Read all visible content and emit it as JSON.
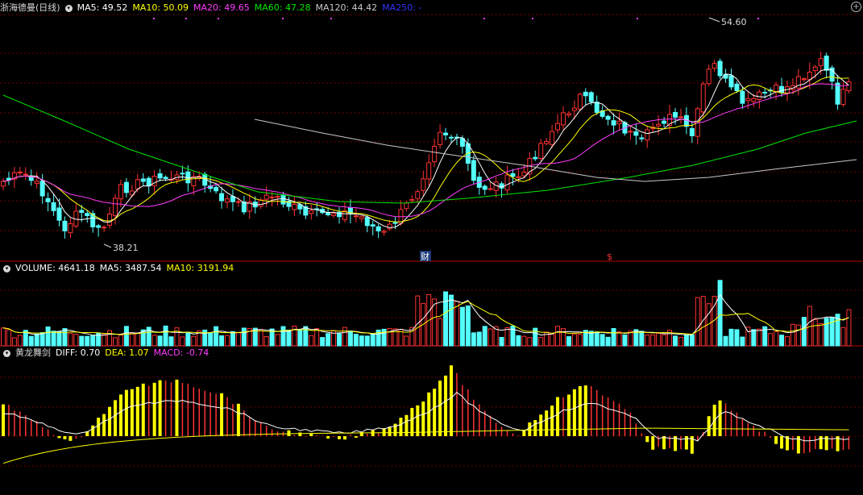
{
  "header_price": {
    "title": "浙海德曼(日线)",
    "ma5": "MA5: 49.52",
    "ma10": "MA10: 50.09",
    "ma20": "MA20: 49.65",
    "ma60": "MA60: 47.28",
    "ma120": "MA120: 44.42",
    "ma250": "MA250: -"
  },
  "header_volume": {
    "title": "VOLUME: 4641.18",
    "ma5": "MA5: 3487.54",
    "ma10": "MA10: 3191.94"
  },
  "header_macd": {
    "title": "黄龙舞剑",
    "diff": "DIFF: 0.70",
    "dea": "DEA: 1.07",
    "macd": "MACD: -0.74"
  },
  "annotations": {
    "high": "54.60",
    "low": "38.21",
    "marker_cai": "财",
    "marker_dollar": "$"
  },
  "colors": {
    "up": "#ff3232",
    "down": "#54ffff",
    "ma5": "#ffffff",
    "ma10": "#ffff00",
    "ma20": "#ff3cff",
    "ma60": "#00e600",
    "ma120": "#c8c8c8",
    "ma250": "#3232ff"
  },
  "chart_data": {
    "type": "candlestick",
    "price_axis": {
      "high_label": 54.6,
      "low_label": 38.21
    },
    "macd": {
      "diff": 0.7,
      "dea": 1.07,
      "macd": -0.74
    }
  }
}
